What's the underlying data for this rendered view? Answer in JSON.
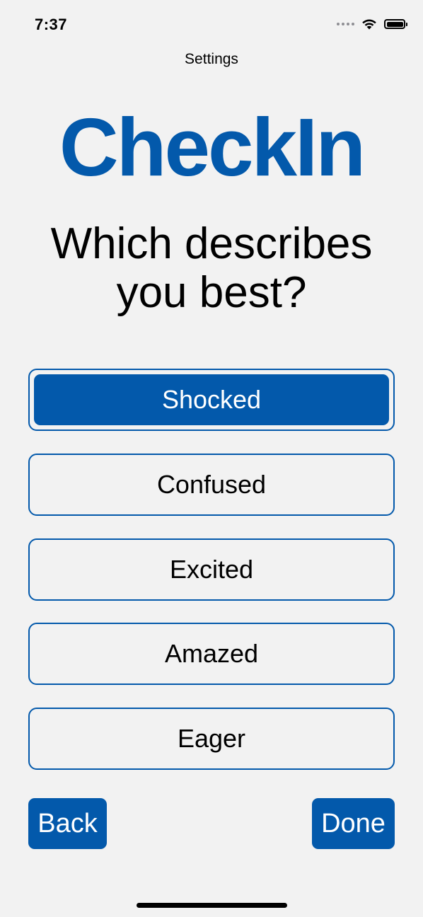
{
  "status_bar": {
    "time": "7:37",
    "icons": [
      "cellular-dots-icon",
      "wifi-icon",
      "battery-icon"
    ]
  },
  "nav": {
    "title": "Settings"
  },
  "app": {
    "title": "CheckIn"
  },
  "question": {
    "line1": "Which describes",
    "line2": "you best?"
  },
  "options": [
    {
      "label": "Shocked",
      "selected": true
    },
    {
      "label": "Confused",
      "selected": false
    },
    {
      "label": "Excited",
      "selected": false
    },
    {
      "label": "Amazed",
      "selected": false
    },
    {
      "label": "Eager",
      "selected": false
    }
  ],
  "buttons": {
    "back_label": "Back",
    "done_label": "Done"
  },
  "colors": {
    "accent": "#0359ab",
    "background": "#f2f2f2"
  }
}
